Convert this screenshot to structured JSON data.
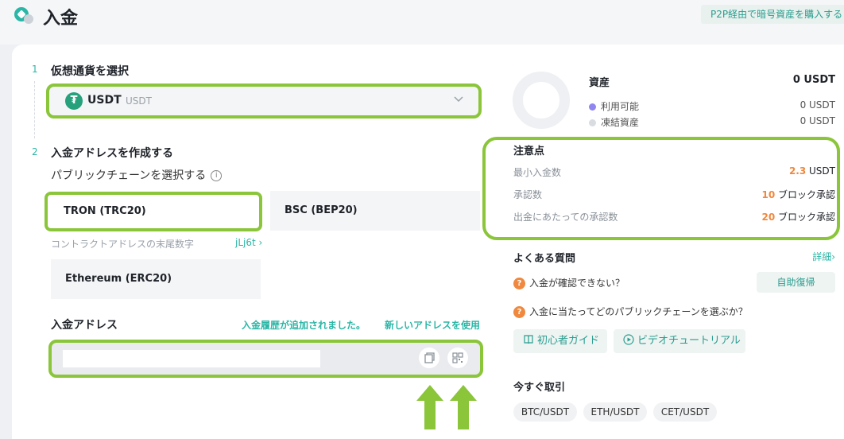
{
  "header": {
    "title": "入金",
    "p2p_button": "P2P経由で暗号資産を購入する"
  },
  "step1": {
    "number": "1",
    "title": "仮想通貨を選択",
    "coin_symbol": "USDT",
    "coin_sub": "USDT",
    "coin_icon_glyph": "₮",
    "icon": "chevron-down-icon"
  },
  "step2": {
    "number": "2",
    "title": "入金アドレスを作成する",
    "subtitle": "パブリックチェーンを選択する",
    "info_glyph": "i",
    "chains": [
      "TRON (TRC20)",
      "BSC (BEP20)",
      "Ethereum (ERC20)"
    ],
    "selected_chain": "TRON (TRC20)",
    "contract_label": "コントラクトアドレスの末尾数字",
    "contract_value": "jLj6t ›"
  },
  "address": {
    "title": "入金アドレス",
    "history_link": "入金履歴が追加されました。",
    "new_address_link": "新しいアドレスを使用",
    "value": ""
  },
  "assets": {
    "title": "資産",
    "total": "0 USDT",
    "available_label": "利用可能",
    "available_value": "0 USDT",
    "frozen_label": "凍結資産",
    "frozen_value": "0 USDT",
    "available_color": "#8f86f0",
    "frozen_color": "#d9dce1"
  },
  "notes": {
    "title": "注意点",
    "min_label": "最小入金数",
    "min_num": "2.3",
    "min_unit": " USDT",
    "confirm_label": "承認数",
    "confirm_num": "10",
    "confirm_unit": " ブロック承認",
    "withdraw_label": "出金にあたっての承認数",
    "withdraw_num": "20",
    "withdraw_unit": " ブロック承認"
  },
  "faq": {
    "title": "よくある質問",
    "more": "詳細›",
    "q_glyph": "?",
    "q1": "入金が確認できない？",
    "recover_button": "自助復帰",
    "q2": "入金に当たってどのパブリックチェーンを選ぶか？",
    "guide_button": "初心者ガイド",
    "video_button": "ビデオチュートリアル"
  },
  "trade": {
    "title": "今すぐ取引",
    "pairs": [
      "BTC/USDT",
      "ETH/USDT",
      "CET/USDT"
    ]
  },
  "accent_color": "#2bb6a6",
  "highlight_color": "#8ac53a"
}
